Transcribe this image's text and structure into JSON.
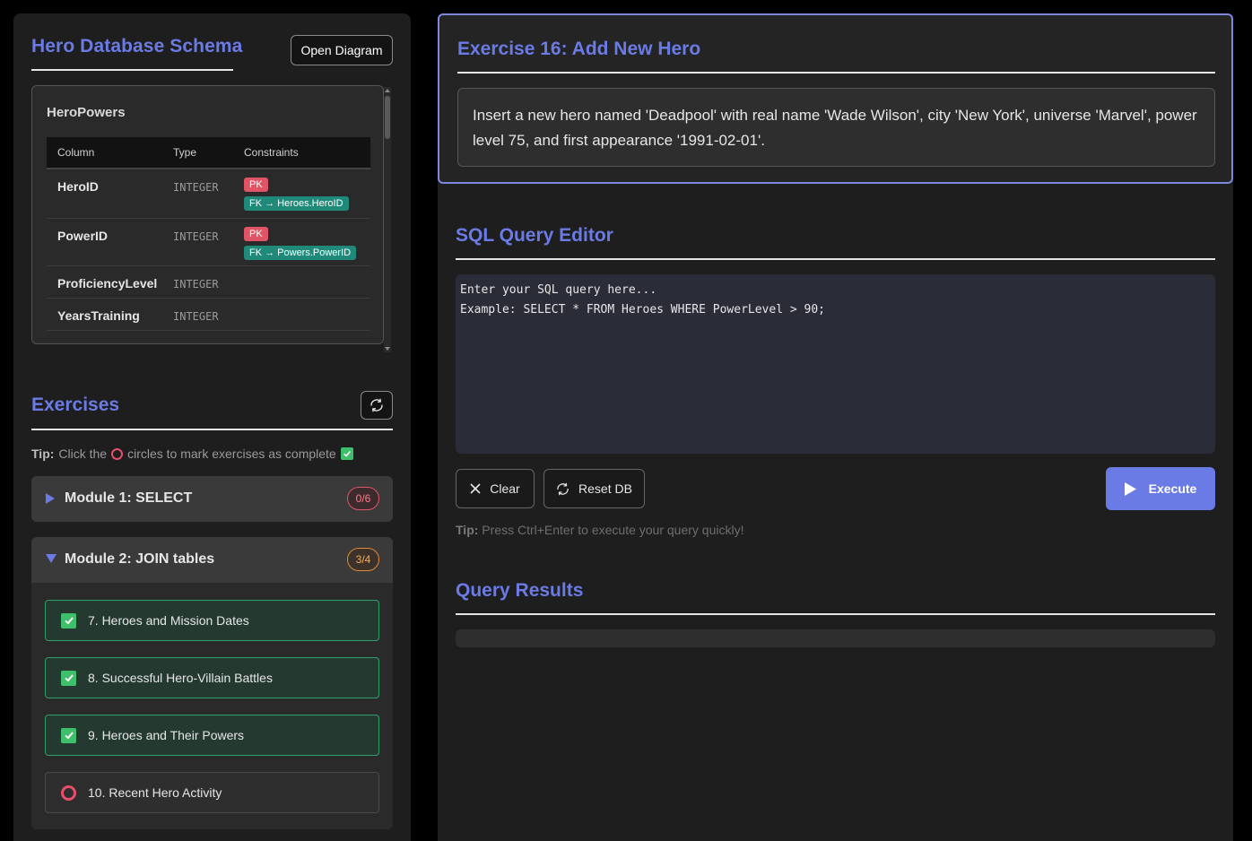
{
  "schema": {
    "title": "Hero Database Schema",
    "open_diagram_label": "Open Diagram",
    "table": {
      "name": "HeroPowers",
      "headers": [
        "Column",
        "Type",
        "Constraints"
      ],
      "rows": [
        {
          "column": "HeroID",
          "type": "INTEGER",
          "pk": "PK",
          "fk": "FK → Heroes.HeroID"
        },
        {
          "column": "PowerID",
          "type": "INTEGER",
          "pk": "PK",
          "fk": "FK → Powers.PowerID"
        },
        {
          "column": "ProficiencyLevel",
          "type": "INTEGER"
        },
        {
          "column": "YearsTraining",
          "type": "INTEGER"
        }
      ]
    }
  },
  "exercises": {
    "title": "Exercises",
    "tip_label": "Tip:",
    "tip_pre": "Click the",
    "tip_post": "circles to mark exercises as complete",
    "modules": [
      {
        "label": "Module 1: SELECT",
        "count": "0/6",
        "expanded": false
      },
      {
        "label": "Module 2: JOIN tables",
        "count": "3/4",
        "expanded": true,
        "items": [
          {
            "label": "7. Heroes and Mission Dates",
            "done": true
          },
          {
            "label": "8. Successful Hero-Villain Battles",
            "done": true
          },
          {
            "label": "9. Heroes and Their Powers",
            "done": true
          },
          {
            "label": "10. Recent Hero Activity",
            "done": false
          }
        ]
      }
    ]
  },
  "exercise": {
    "title": "Exercise 16: Add New Hero",
    "description": "Insert a new hero named 'Deadpool' with real name 'Wade Wilson', city 'New York', universe 'Marvel', power level 75, and first appearance '1991-02-01'."
  },
  "editor": {
    "title": "SQL Query Editor",
    "placeholder": "Enter your SQL query here...\nExample: SELECT * FROM Heroes WHERE PowerLevel > 90;",
    "clear_label": "Clear",
    "reset_label": "Reset DB",
    "execute_label": "Execute",
    "tip_label": "Tip:",
    "tip_text": "Press Ctrl+Enter to execute your query quickly!"
  },
  "results": {
    "title": "Query Results"
  },
  "colors": {
    "accent": "#6b7be6",
    "done_green": "#3fbf6a",
    "todo_red": "#e94e6a"
  }
}
